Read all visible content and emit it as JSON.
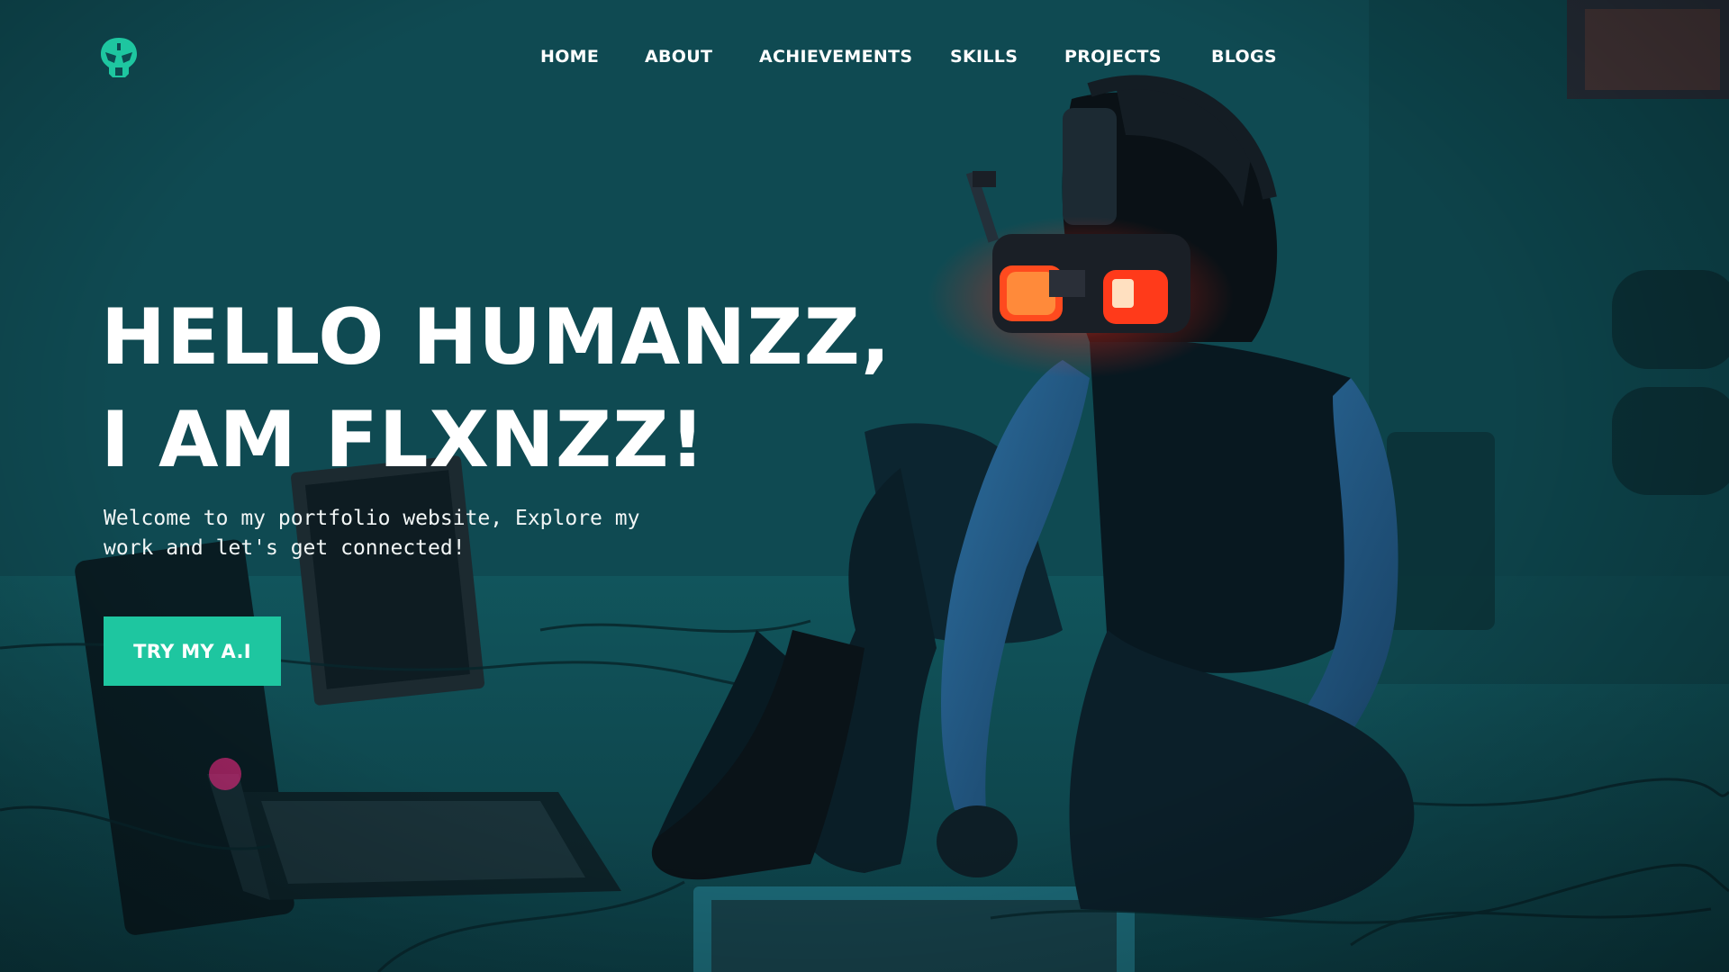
{
  "nav": {
    "logo_icon": "alien-skull-logo-icon",
    "items": [
      {
        "label": "HOME"
      },
      {
        "label": "ABOUT"
      },
      {
        "label": "ACHIEVEMENTS"
      },
      {
        "label": "SKILLS"
      },
      {
        "label": "PROJECTS"
      },
      {
        "label": "BLOGS"
      }
    ]
  },
  "hero": {
    "headline_line1": "HELLO HUMANZZ,",
    "headline_line2": "I AM FLXNZZ!",
    "intro": "Welcome to my portfolio website, Explore my work and let's get connected!",
    "cta_label": "TRY MY A.I",
    "background": "person-with-vr-headset-photo"
  },
  "colors": {
    "accent": "#1ec6a0",
    "background": "#0d4a50",
    "text": "#ffffff",
    "visor_glow": "#ff3b1a"
  }
}
